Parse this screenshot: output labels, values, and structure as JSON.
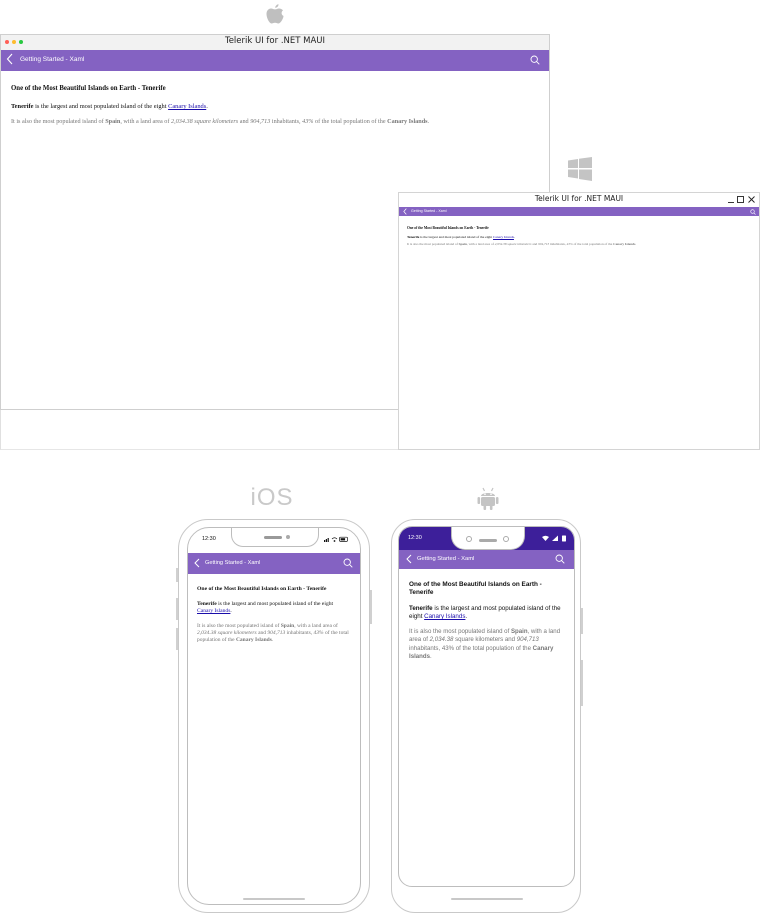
{
  "app": {
    "window_title": "Telerik UI for .NET MAUI",
    "nav_title": "Getting Started - Xaml"
  },
  "article": {
    "heading": "One of the Most Beautiful Islands on Earth - Tenerife",
    "p1_bold": "Tenerife",
    "p1_text": " is the largest and most populated island of the eight ",
    "p1_link": "Canary Islands",
    "p1_end": ".",
    "p2_a": "It is also the most populated island of ",
    "p2_spain": "Spain",
    "p2_b": ", with a land area of ",
    "p2_area": "2,034.38 square kilometers",
    "p2_c": " and ",
    "p2_inhab": "904,713",
    "p2_d": " inhabitants, ",
    "p2_pct": "43%",
    "p2_e": " of the total population of the ",
    "p2_canary": "Canary Islands",
    "p2_end": "."
  },
  "android_p2": {
    "a": "It is also the most populated island of ",
    "b": ", with a land area of ",
    "area": "2,034.38",
    "c": " square kilometers and ",
    "d": " inhabitants, 43% of the total population of the "
  },
  "platforms": {
    "ios_label": "iOS"
  },
  "status": {
    "ios_time": "12:30",
    "android_time": "12:30"
  },
  "colors": {
    "accent": "#8462c2",
    "android_status": "#3d1f9a"
  },
  "icons": [
    "apple-logo-icon",
    "windows-logo-icon",
    "android-logo-icon",
    "back-chevron-icon",
    "search-icon"
  ]
}
